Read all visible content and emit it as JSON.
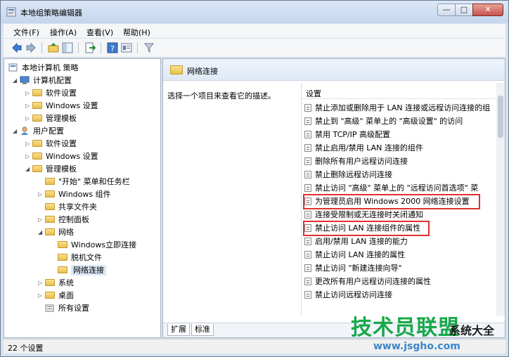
{
  "window": {
    "title": "本地组策略编辑器",
    "min_glyph": "—",
    "max_glyph": "□",
    "close_glyph": "✕"
  },
  "menu": [
    "文件(F)",
    "操作(A)",
    "查看(V)",
    "帮助(H)"
  ],
  "tree": {
    "root": "本地计算机 策略",
    "computer": "计算机配置",
    "c_software": "软件设置",
    "c_windows": "Windows 设置",
    "c_admin": "管理模板",
    "user": "用户配置",
    "u_software": "软件设置",
    "u_windows": "Windows 设置",
    "u_admin": "管理模板",
    "start_menu": "\"开始\" 菜单和任务栏",
    "win_components": "Windows 组件",
    "shared_folders": "共享文件夹",
    "control_panel": "控制面板",
    "network": "网络",
    "windows_connect_now": "Windows立即连接",
    "offline_files": "脱机文件",
    "network_connections": "网络连接",
    "system": "系统",
    "desktop": "桌面",
    "all_settings": "所有设置"
  },
  "right": {
    "title": "网络连接",
    "description": "选择一个项目来查看它的描述。",
    "column": "设置",
    "settings": [
      "禁止添加或删除用于 LAN 连接或远程访问连接的组",
      "禁止到 \"高级\" 菜单上的 \"高级设置\" 的访问",
      "禁用 TCP/IP 高级配置",
      "禁止启用/禁用 LAN 连接的组件",
      "删除所有用户远程访问连接",
      "禁止删除远程访问连接",
      "禁止访问 \"高级\" 菜单上的 \"远程访问首选项\" 菜",
      "为管理员启用 Windows 2000 网络连接设置",
      "连接受限制或无连接时关闭通知",
      "禁止访问 LAN 连接组件的属性",
      "启用/禁用 LAN 连接的能力",
      "禁止访问 LAN 连接的属性",
      "禁止访问 \"新建连接向导\"",
      "更改所有用户远程访问连接的属性",
      "禁止访问远程访问连接"
    ],
    "tabs": [
      "扩展",
      "标准"
    ]
  },
  "status": "22 个设置",
  "watermark": {
    "brand": "技术员联盟",
    "suffix": "系统大全",
    "url": "www.jsgho.com"
  }
}
